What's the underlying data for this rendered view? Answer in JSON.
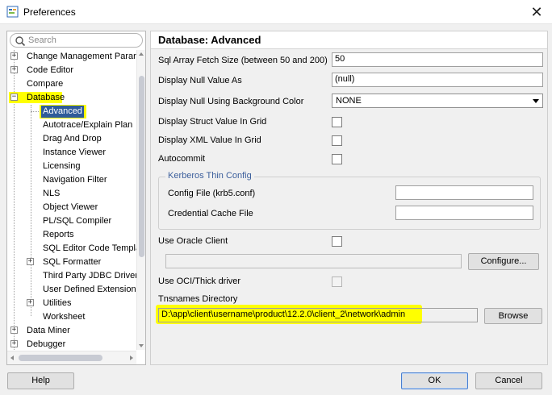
{
  "window": {
    "title": "Preferences",
    "close_glyph": "✕",
    "icon": "preferences-app-icon"
  },
  "search": {
    "placeholder": "Search"
  },
  "tree": {
    "expander_glyph": "+",
    "collapse_glyph": "−",
    "items": [
      {
        "label": "Change Management Parar",
        "expandable": true
      },
      {
        "label": "Code Editor",
        "expandable": true
      },
      {
        "label": "Compare",
        "expandable": false
      },
      {
        "label": "Database",
        "expandable": true,
        "expanded": true,
        "highlighted": true
      },
      {
        "label": "Advanced",
        "selected": true,
        "highlighted": true
      },
      {
        "label": "Autotrace/Explain Plan"
      },
      {
        "label": "Drag And Drop"
      },
      {
        "label": "Instance Viewer"
      },
      {
        "label": "Licensing"
      },
      {
        "label": "Navigation Filter"
      },
      {
        "label": "NLS"
      },
      {
        "label": "Object Viewer"
      },
      {
        "label": "PL/SQL Compiler"
      },
      {
        "label": "Reports"
      },
      {
        "label": "SQL Editor Code Templa"
      },
      {
        "label": "SQL Formatter",
        "expandable": true
      },
      {
        "label": "Third Party JDBC Driver"
      },
      {
        "label": "User Defined Extension"
      },
      {
        "label": "Utilities",
        "expandable": true
      },
      {
        "label": "Worksheet"
      },
      {
        "label": "Data Miner",
        "expandable": true
      },
      {
        "label": "Debugger",
        "expandable": true
      }
    ]
  },
  "panel": {
    "title": "Database: Advanced",
    "sql_fetch": {
      "label": "Sql Array Fetch Size (between 50 and 200)",
      "value": "50"
    },
    "null_value": {
      "label": "Display Null Value As",
      "value": "(null)"
    },
    "null_bg": {
      "label": "Display Null Using Background Color",
      "value": "NONE"
    },
    "struct_grid": {
      "label": "Display Struct Value In Grid",
      "checked": false
    },
    "xml_grid": {
      "label": "Display XML Value In Grid",
      "checked": false
    },
    "autocommit": {
      "label": "Autocommit",
      "checked": false
    },
    "kerberos": {
      "title": "Kerberos Thin Config",
      "config_file": {
        "label": "Config File (krb5.conf)",
        "value": ""
      },
      "cred_cache": {
        "label": "Credential Cache File",
        "value": ""
      }
    },
    "oracle_client": {
      "label": "Use Oracle Client",
      "checked": false,
      "path": "",
      "configure_label": "Configure..."
    },
    "oci_thick": {
      "label": "Use OCI/Thick driver",
      "checked": false,
      "disabled": true
    },
    "tnsnames": {
      "label": "Tnsnames Directory",
      "value": "D:\\app\\client\\username\\product\\12.2.0\\client_2\\network\\admin",
      "browse_label": "Browse"
    }
  },
  "footer": {
    "help_label": "Help",
    "ok_label": "OK",
    "cancel_label": "Cancel"
  },
  "colors": {
    "selection": "#2f5b9a",
    "highlight": "#ffff00",
    "group_title": "#3c5f9c"
  }
}
